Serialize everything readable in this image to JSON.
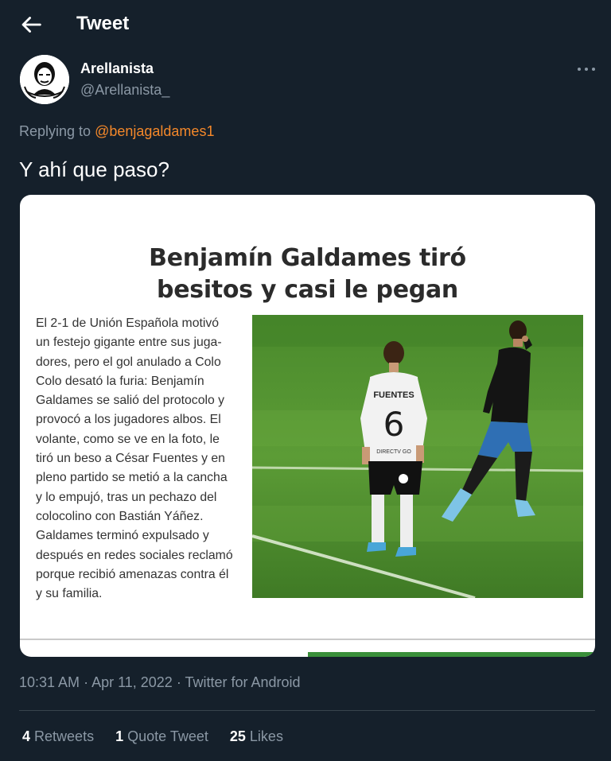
{
  "header": {
    "title": "Tweet"
  },
  "author": {
    "name": "Arellanista",
    "handle": "@Arellanista_"
  },
  "reply": {
    "prefix": "Replying to",
    "mention": "@benjagaldames1"
  },
  "tweet": {
    "text": "Y ahí que paso?"
  },
  "media": {
    "headline_line1": "Benjamín Galdames tiró",
    "headline_line2": "besitos y casi le pegan",
    "article_text": "El 2-1 de Unión Española motivó\nun festejo gigante entre sus juga-\ndores, pero el gol anulado a Colo\nColo desató la furia: Benjamín\nGaldames se salió del protocolo y\nprovocó a los jugadores albos. El\nvolante, como se ve en la foto, le\ntiró un beso a César Fuentes y en\npleno partido se metió a la cancha\ny lo empujó, tras un pechazo del\ncolocolino con Bastián Yáñez.\nGaldames terminó expulsado y\ndespués en redes sociales reclamó\nporque recibió amenazas contra él\ny su familia.",
    "jersey_name": "FUENTES",
    "jersey_number": "6",
    "jersey_sponsor": "DIRECTV GO"
  },
  "meta": {
    "time": "10:31 AM",
    "separator": " · ",
    "date": "Apr 11, 2022",
    "source": "Twitter for Android"
  },
  "stats": {
    "retweets_count": "4",
    "retweets_label": "Retweets",
    "quotes_count": "1",
    "quotes_label": "Quote Tweet",
    "likes_count": "25",
    "likes_label": "Likes"
  },
  "icons": {
    "back": "arrow-left-icon",
    "more": "more-horizontal-icon"
  },
  "colors": {
    "background": "#15202b",
    "mention": "#f4882a",
    "secondary_text": "#8b98a5"
  }
}
